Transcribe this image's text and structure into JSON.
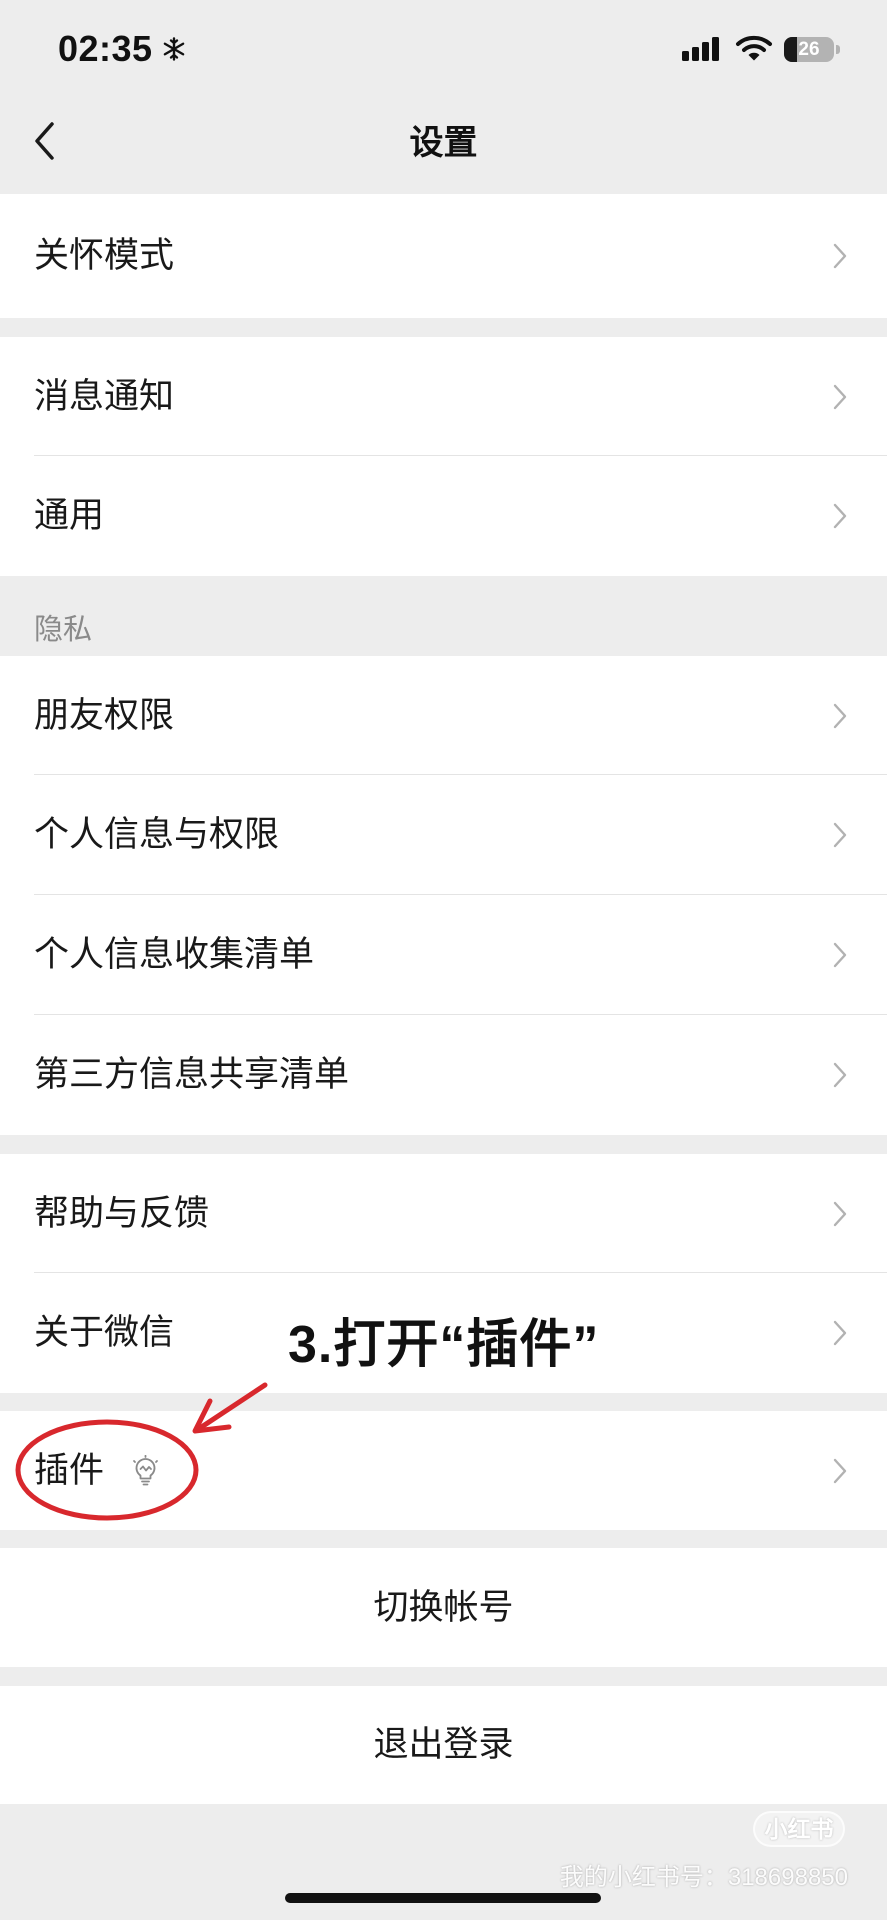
{
  "status_bar": {
    "time": "02:35",
    "battery_level": "26"
  },
  "nav": {
    "title": "设置"
  },
  "groups": [
    {
      "items": [
        {
          "label": "关怀模式"
        }
      ]
    },
    {
      "items": [
        {
          "label": "消息通知"
        },
        {
          "label": "通用"
        }
      ]
    },
    {
      "header": "隐私",
      "items": [
        {
          "label": "朋友权限"
        },
        {
          "label": "个人信息与权限"
        },
        {
          "label": "个人信息收集清单"
        },
        {
          "label": "第三方信息共享清单"
        }
      ]
    },
    {
      "items": [
        {
          "label": "帮助与反馈"
        },
        {
          "label": "关于微信"
        }
      ]
    },
    {
      "items": [
        {
          "label": "插件",
          "badge_icon": "lightbulb-icon"
        }
      ]
    },
    {
      "items": [
        {
          "label": "切换帐号"
        }
      ]
    },
    {
      "items": [
        {
          "label": "退出登录"
        }
      ]
    }
  ],
  "annotation": {
    "text": "3.打开“插件”"
  },
  "watermark": {
    "logo": "小红书",
    "account_id": "我的小红书号：318698850"
  },
  "icons": {
    "status": [
      "snowflake-icon",
      "cellular-signal-icon",
      "wifi-icon",
      "battery-icon"
    ],
    "back": "chevron-left-icon",
    "row_disclosure": "chevron-right-icon",
    "plugins_badge": "lightbulb-icon"
  },
  "colors": {
    "background": "#EDEDED",
    "row_background": "#FFFFFF",
    "annotation_red": "#D8282D",
    "chevron": "#B2B2B2"
  }
}
